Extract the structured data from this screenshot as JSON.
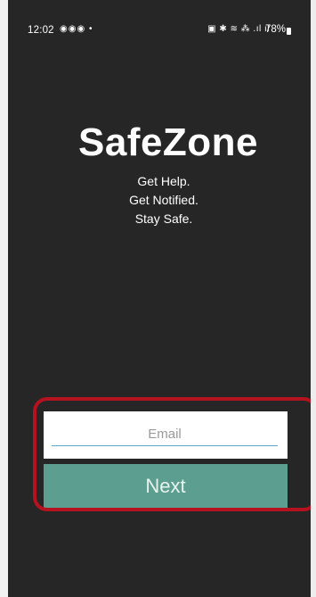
{
  "status_bar": {
    "time": "12:02",
    "notification_icons": "◉◉◉ •",
    "system_icons": "▣ ✱ ≋ ⁂ .ıl ıl",
    "battery": "78%"
  },
  "app": {
    "title": "SafeZone",
    "tagline_lines": [
      "Get Help.",
      "Get Notified.",
      "Stay Safe."
    ]
  },
  "form": {
    "email_placeholder": "Email",
    "email_value": "",
    "next_label": "Next"
  },
  "colors": {
    "background": "#262626",
    "button": "#5c9e8f",
    "highlight": "#b3121e",
    "input_underline": "#5aa9c9"
  }
}
